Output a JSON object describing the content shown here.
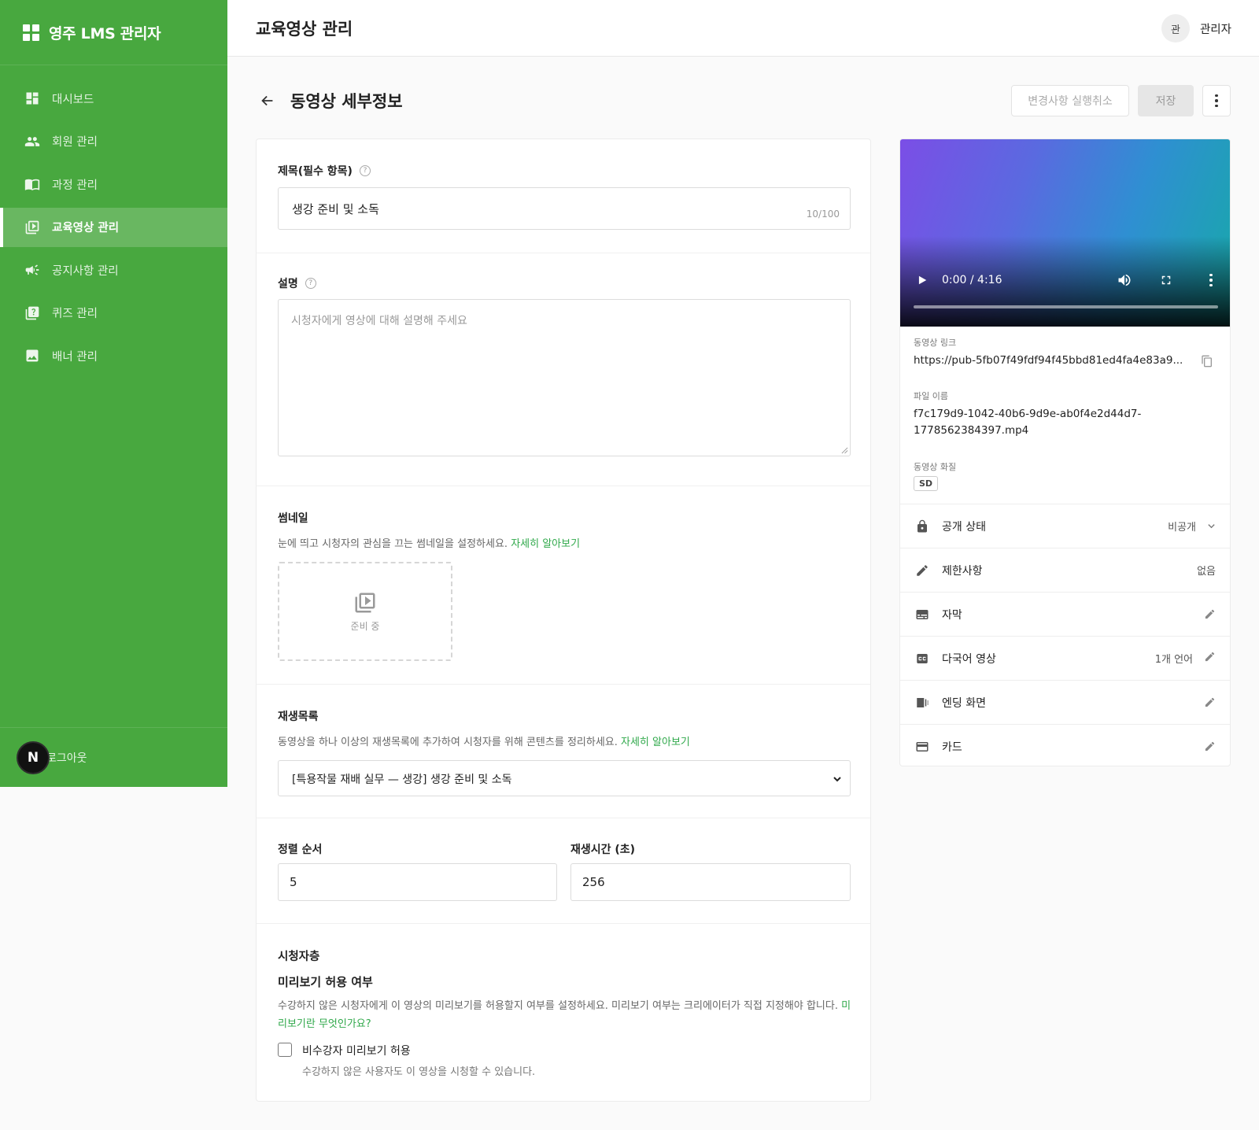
{
  "sidebar": {
    "brand": "영주 LMS 관리자",
    "items": [
      {
        "label": "대시보드",
        "icon": "dashboard-icon"
      },
      {
        "label": "회원 관리",
        "icon": "users-icon"
      },
      {
        "label": "과정 관리",
        "icon": "book-icon"
      },
      {
        "label": "교육영상 관리",
        "icon": "video-library-icon",
        "active": true
      },
      {
        "label": "공지사항 관리",
        "icon": "megaphone-icon"
      },
      {
        "label": "퀴즈 관리",
        "icon": "quiz-icon"
      },
      {
        "label": "배너 관리",
        "icon": "image-icon"
      }
    ],
    "logout_badge": "N",
    "logout": "로그아웃"
  },
  "header": {
    "title": "교육영상 관리",
    "avatar": "관",
    "user": "관리자"
  },
  "page": {
    "title": "동영상 세부정보",
    "undo_label": "변경사항 실행취소",
    "save_label": "저장"
  },
  "form": {
    "title_label": "제목(필수 항목)",
    "title_value": "생강 준비 및 소독",
    "title_counter": "10/100",
    "desc_label": "설명",
    "desc_placeholder": "시청자에게 영상에 대해 설명해 주세요",
    "thumb_label": "썸네일",
    "thumb_help": "눈에 띄고 시청자의 관심을 끄는 썸네일을 설정하세요.",
    "thumb_link": "자세히 알아보기",
    "thumb_status": "준비 중",
    "playlist_label": "재생목록",
    "playlist_help": "동영상을 하나 이상의 재생목록에 추가하여 시청자를 위해 콘텐츠를 정리하세요.",
    "playlist_link": "자세히 알아보기",
    "playlist_selected": "[특용작물 재배 실무 — 생강] 생강 준비 및 소독",
    "order_label": "정렬 순서",
    "order_value": "5",
    "duration_label": "재생시간 (초)",
    "duration_value": "256",
    "audience_label": "시청자층",
    "preview_title": "미리보기 허용 여부",
    "preview_help": "수강하지 않은 시청자에게 이 영상의 미리보기를 허용할지 여부를 설정하세요. 미리보기 여부는 크리에이터가 직접 지정해야 합니다.",
    "preview_link": "미리보기란 무엇인가요?",
    "checkbox_label": "비수강자 미리보기 허용",
    "checkbox_help": "수강하지 않은 사용자도 이 영상을 시청할 수 있습니다.",
    "checkbox_checked": false
  },
  "video": {
    "time": "0:00 / 4:16",
    "progress": 0,
    "link_label": "동영상 링크",
    "link": "https://pub-5fb07f49fdf94f45bbd81ed4fa4e83a9...",
    "filename_label": "파일 이름",
    "filename_line1": "f7c179d9-1042-40b6-9d9e-ab0f4e2d44d7-",
    "filename_line2": "1778562384397.mp4",
    "quality_label": "동영상 화질",
    "quality": "SD"
  },
  "settings": [
    {
      "label": "공개 상태",
      "icon": "lock-icon",
      "value": "비공개",
      "control": "chevron"
    },
    {
      "label": "제한사항",
      "icon": "pencil-icon",
      "value": "없음",
      "control": "none"
    },
    {
      "label": "자막",
      "icon": "subtitles-icon",
      "value": "",
      "control": "edit"
    },
    {
      "label": "다국어 영상",
      "icon": "closed-caption-icon",
      "value": "1개 언어",
      "control": "edit"
    },
    {
      "label": "엔딩 화면",
      "icon": "end-screen-icon",
      "value": "",
      "control": "edit"
    },
    {
      "label": "카드",
      "icon": "card-icon",
      "value": "",
      "control": "edit"
    }
  ],
  "colors": {
    "sidebar": "#48a83f",
    "link": "#2fa84a"
  }
}
